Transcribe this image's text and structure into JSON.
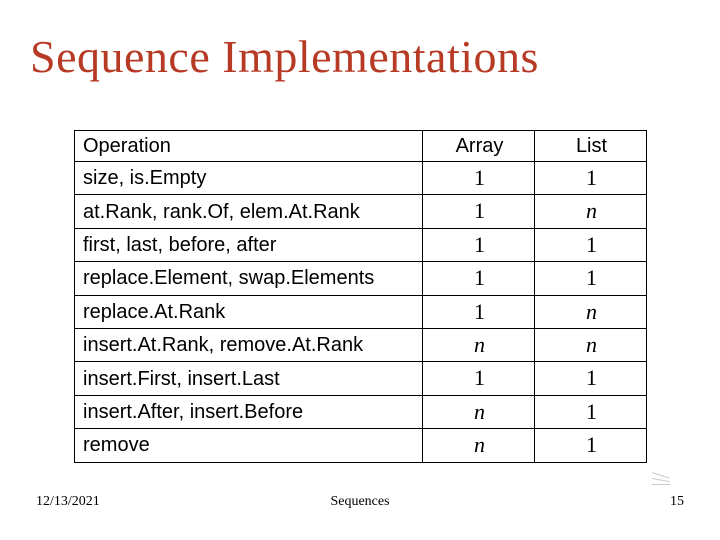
{
  "title": "Sequence Implementations",
  "headers": {
    "operation": "Operation",
    "array": "Array",
    "list": "List"
  },
  "rows": [
    {
      "op": "size, is.Empty",
      "array": "1",
      "list": "1",
      "arrayItalic": false,
      "listItalic": false
    },
    {
      "op": "at.Rank, rank.Of, elem.At.Rank",
      "array": "1",
      "list": "n",
      "arrayItalic": false,
      "listItalic": true
    },
    {
      "op": "first, last, before, after",
      "array": "1",
      "list": "1",
      "arrayItalic": false,
      "listItalic": false
    },
    {
      "op": "replace.Element, swap.Elements",
      "array": "1",
      "list": "1",
      "arrayItalic": false,
      "listItalic": false
    },
    {
      "op": "replace.At.Rank",
      "array": "1",
      "list": "n",
      "arrayItalic": false,
      "listItalic": true
    },
    {
      "op": "insert.At.Rank, remove.At.Rank",
      "array": "n",
      "list": "n",
      "arrayItalic": true,
      "listItalic": true
    },
    {
      "op": "insert.First, insert.Last",
      "array": "1",
      "list": "1",
      "arrayItalic": false,
      "listItalic": false
    },
    {
      "op": "insert.After, insert.Before",
      "array": "n",
      "list": "1",
      "arrayItalic": true,
      "listItalic": false
    },
    {
      "op": "remove",
      "array": "n",
      "list": "1",
      "arrayItalic": true,
      "listItalic": false
    }
  ],
  "footer": {
    "date": "12/13/2021",
    "center": "Sequences",
    "page": "15"
  },
  "chart_data": {
    "type": "table",
    "title": "Sequence Implementations",
    "columns": [
      "Operation",
      "Array",
      "List"
    ],
    "rows": [
      [
        "size, is.Empty",
        "1",
        "1"
      ],
      [
        "at.Rank, rank.Of, elem.At.Rank",
        "1",
        "n"
      ],
      [
        "first, last, before, after",
        "1",
        "1"
      ],
      [
        "replace.Element, swap.Elements",
        "1",
        "1"
      ],
      [
        "replace.At.Rank",
        "1",
        "n"
      ],
      [
        "insert.At.Rank, remove.At.Rank",
        "n",
        "n"
      ],
      [
        "insert.First, insert.Last",
        "1",
        "1"
      ],
      [
        "insert.After, insert.Before",
        "n",
        "1"
      ],
      [
        "remove",
        "n",
        "1"
      ]
    ]
  }
}
